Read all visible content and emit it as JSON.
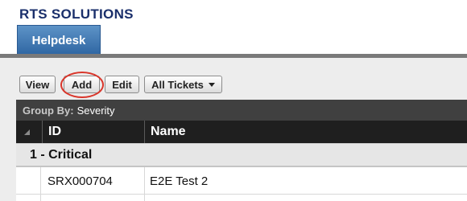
{
  "header": {
    "brand": "RTS SOLUTIONS",
    "tab_label": "Helpdesk"
  },
  "toolbar": {
    "view_label": "View",
    "add_label": "Add",
    "edit_label": "Edit",
    "filter_label": "All Tickets",
    "highlighted": "Add"
  },
  "group_bar": {
    "label": "Group By:",
    "value": "Severity"
  },
  "table": {
    "columns": [
      "ID",
      "Name"
    ],
    "groups": [
      {
        "label": "1 - Critical",
        "rows": [
          {
            "id": "SRX000704",
            "name": "E2E Test 2"
          }
        ]
      }
    ]
  },
  "colors": {
    "brand": "#1a2f6b",
    "tab": "#3a72ad",
    "highlight_ring": "#d9362b",
    "group_bar_bg": "#404040",
    "header_bg": "#1f1f1f"
  },
  "icons": {
    "filter_dropdown": "chevron-down-icon",
    "sort_indicator": "sort-triangle-icon"
  }
}
